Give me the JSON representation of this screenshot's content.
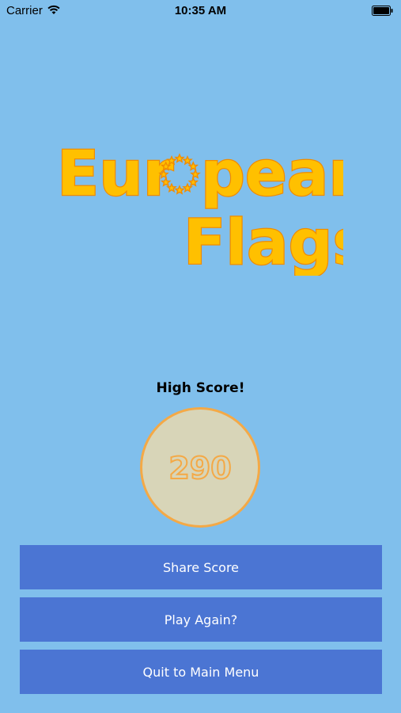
{
  "status_bar": {
    "carrier": "Carrier",
    "time": "10:35 AM"
  },
  "logo": {
    "line1_prefix": "Eur",
    "line1_suffix": "pean",
    "line2": "Flags",
    "fill_color": "#ffc000",
    "outline_color": "#f08c00"
  },
  "score": {
    "label": "High Score!",
    "value": "290"
  },
  "buttons": {
    "share": "Share Score",
    "play_again": "Play Again?",
    "quit": "Quit to Main Menu"
  },
  "colors": {
    "background": "#80bfec",
    "button": "#4b75d3",
    "circle_fill": "#d8d5b8",
    "circle_border": "#f4a946"
  }
}
